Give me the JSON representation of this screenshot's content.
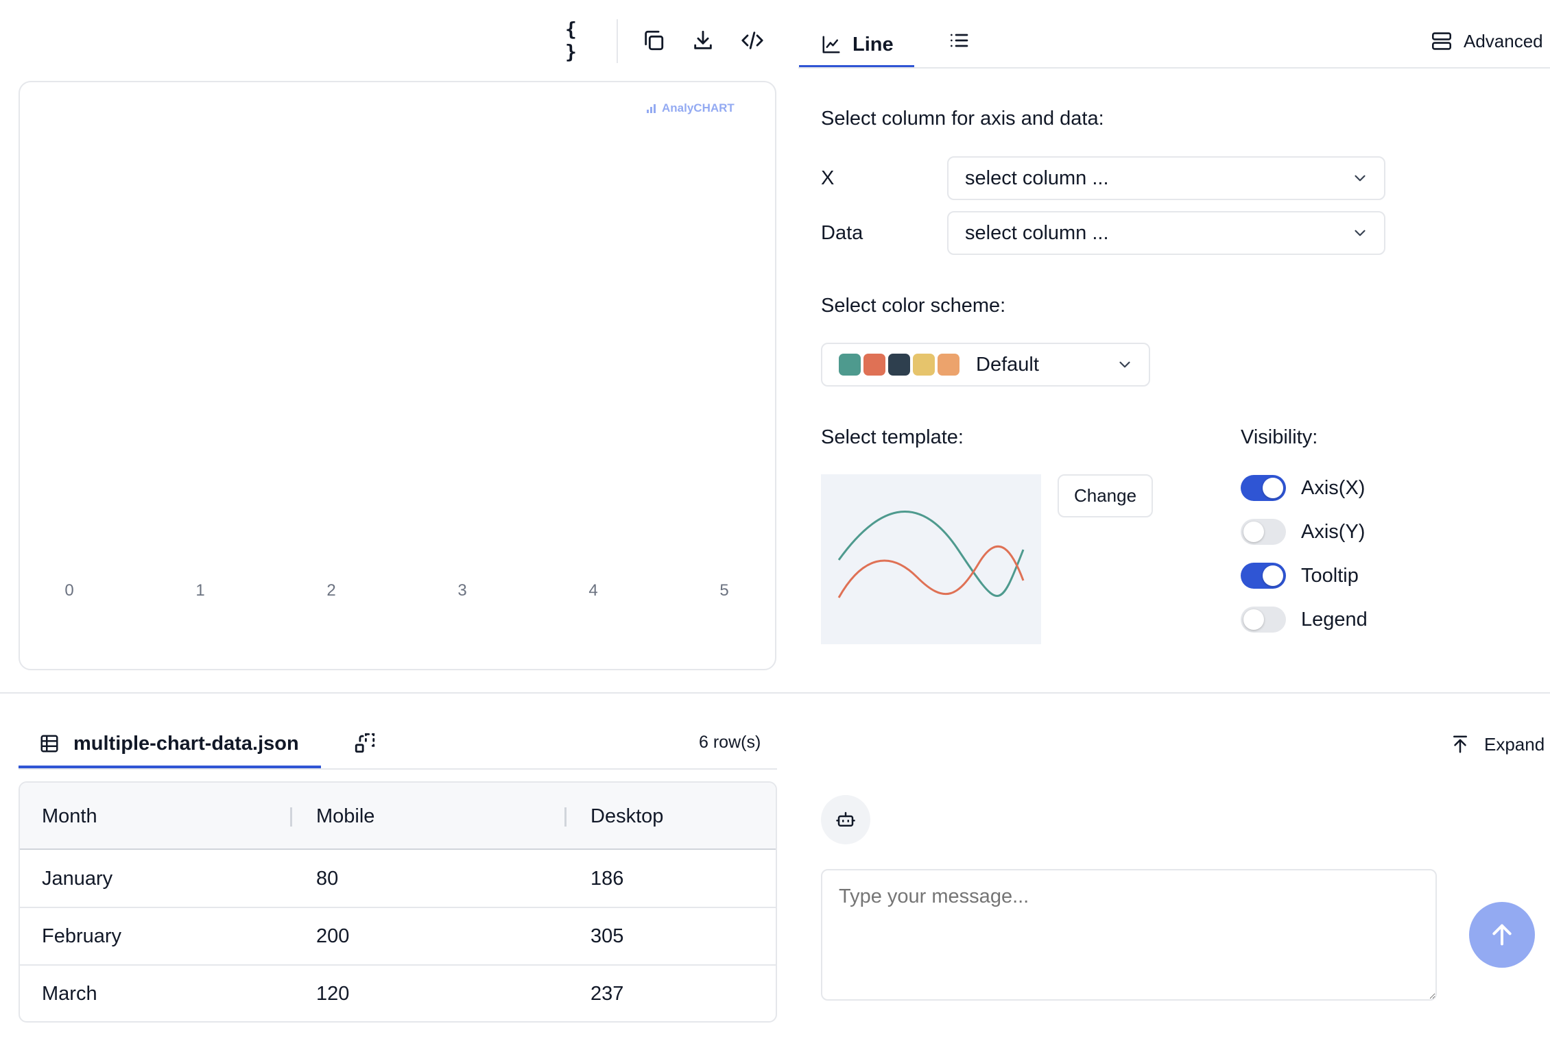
{
  "toolbar": {
    "json_label": "{ }",
    "copy_icon": "copy-icon",
    "download_icon": "download-icon",
    "code_icon": "code-icon"
  },
  "chart_preview": {
    "brand": "AnalyCHART",
    "x_ticks": [
      "0",
      "1",
      "2",
      "3",
      "4",
      "5"
    ]
  },
  "settings_tabs": {
    "line_label": "Line",
    "advanced_label": "Advanced"
  },
  "axis_section": {
    "title": "Select column for axis and data:",
    "x_label": "X",
    "x_value": "select column ...",
    "data_label": "Data",
    "data_value": "select column ..."
  },
  "color_scheme": {
    "title": "Select color scheme:",
    "value": "Default",
    "swatches": [
      "#4e9a8e",
      "#df7155",
      "#2e3f4e",
      "#e6c46c",
      "#eca36c"
    ]
  },
  "template": {
    "title": "Select template:",
    "change_label": "Change",
    "line_colors": [
      "#4e9a8e",
      "#df7155"
    ]
  },
  "visibility": {
    "title": "Visibility:",
    "toggles": [
      {
        "label": "Axis(X)",
        "on": true
      },
      {
        "label": "Axis(Y)",
        "on": false
      },
      {
        "label": "Tooltip",
        "on": true
      },
      {
        "label": "Legend",
        "on": false
      }
    ]
  },
  "data_panel": {
    "file_name": "multiple-chart-data.json",
    "row_count": "6 row(s)",
    "expand_label": "Expand",
    "columns": [
      "Month",
      "Mobile",
      "Desktop"
    ],
    "rows": [
      [
        "January",
        "80",
        "186"
      ],
      [
        "February",
        "200",
        "305"
      ],
      [
        "March",
        "120",
        "237"
      ]
    ]
  },
  "chat": {
    "placeholder": "Type your message..."
  },
  "colors": {
    "accent": "#2f55d4",
    "send_button": "#93aaf2"
  }
}
